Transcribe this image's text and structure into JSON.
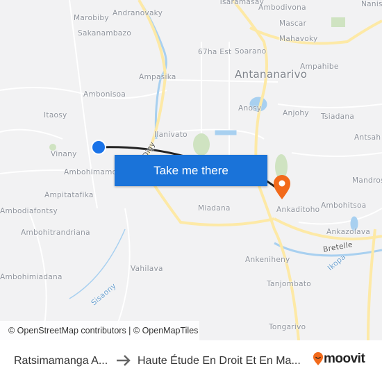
{
  "map": {
    "labels": [
      "Tsaramasay",
      "Ambodivona",
      "Nanis",
      "Marobiby",
      "Andranovaky",
      "Mascar",
      "Sakanambazo",
      "Mahavoky",
      "67ha Est",
      "Soarano",
      "Ampahibe",
      "Antananarivo",
      "Ampasika",
      "Ambonisoa",
      "Anosy",
      "Anjohy",
      "Tsiadana",
      "Itaosy",
      "Ilanivato",
      "Antsah",
      "Vinany",
      "Ambohimamo",
      "Mandros",
      "Ampitatafika",
      "Ankaditoho",
      "Ambohitsoa",
      "Ambodiafontsy",
      "Miadana",
      "Ankazolava",
      "Ambohitrandriana",
      "Bretelle",
      "Ankeniheny",
      "Ikopa",
      "Vahilava",
      "Tanjombato",
      "Ambohimiadana",
      "Sisaony",
      "Tongarivo",
      "Digy"
    ],
    "route_color": "#222222",
    "origin_color": "#1a73e8",
    "destination_color": "#f26a1b",
    "attribution": "© OpenStreetMap contributors | © OpenMapTiles"
  },
  "cta": {
    "label": "Take me there"
  },
  "footer": {
    "from": "Ratsimamanga A...",
    "to": "Haute Étude En Droit Et En Ma...",
    "brand": "moovit",
    "brand_color": "#f26a1b"
  }
}
